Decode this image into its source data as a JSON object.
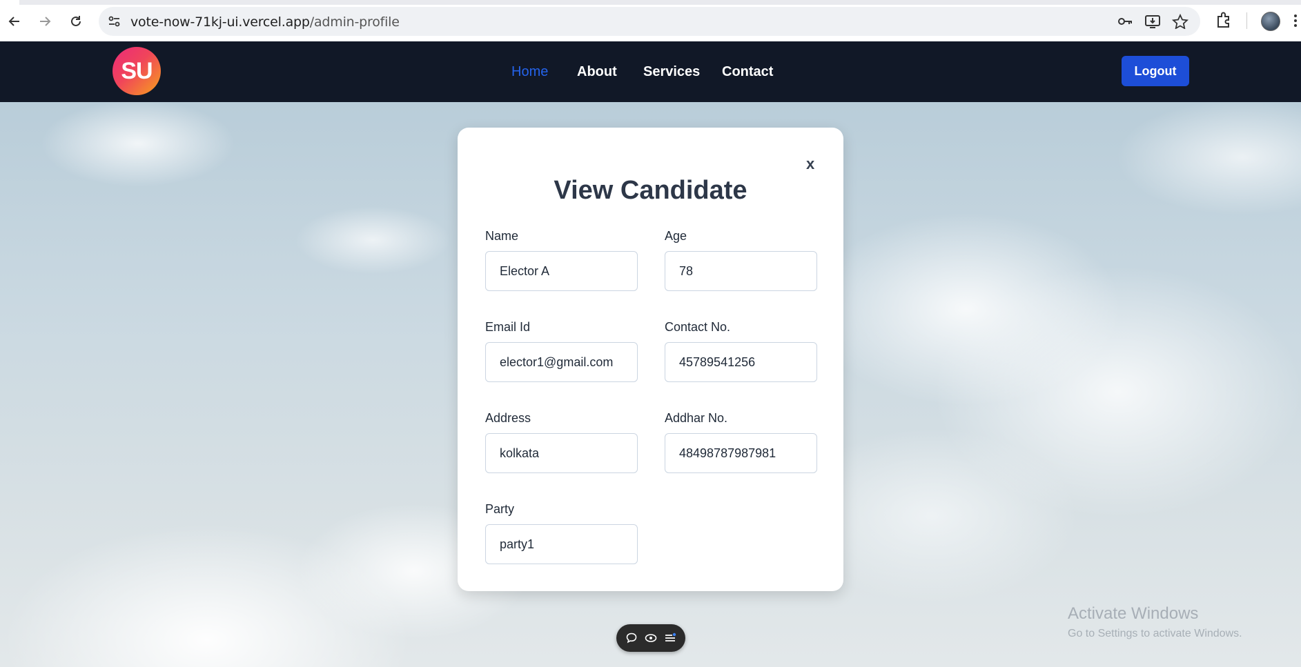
{
  "browser": {
    "url_domain": "vote-now-71kj-ui.vercel.app",
    "url_path": "/admin-profile",
    "icons": [
      "back-icon",
      "forward-icon",
      "reload-icon",
      "site-info-icon",
      "password-key-icon",
      "install-app-icon",
      "bookmark-star-icon",
      "extensions-icon",
      "profile-avatar",
      "menu-kebab-icon"
    ]
  },
  "header": {
    "logo_text": "SU",
    "nav": {
      "home": "Home",
      "about": "About",
      "services": "Services",
      "contact": "Contact"
    },
    "logout_label": "Logout",
    "colors": {
      "background": "#111827",
      "active_link": "#2563eb",
      "button": "#1d4ed8"
    }
  },
  "modal": {
    "close_label": "x",
    "title": "View Candidate",
    "fields": {
      "name": {
        "label": "Name",
        "value": "Elector A"
      },
      "age": {
        "label": "Age",
        "value": "78"
      },
      "email": {
        "label": "Email Id",
        "value": "elector1@gmail.com"
      },
      "contact": {
        "label": "Contact No.",
        "value": "45789541256"
      },
      "address": {
        "label": "Address",
        "value": "kolkata"
      },
      "addhar": {
        "label": "Addhar No.",
        "value": "48498787987981"
      },
      "party": {
        "label": "Party",
        "value": "party1"
      }
    }
  },
  "toolbar": {
    "icons": [
      "comment-icon",
      "eye-icon",
      "list-icon"
    ]
  },
  "watermark": {
    "title": "Activate Windows",
    "subtitle": "Go to Settings to activate Windows."
  }
}
